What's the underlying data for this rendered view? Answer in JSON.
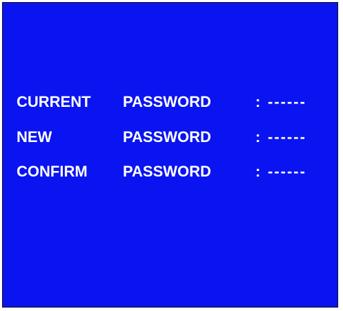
{
  "colors": {
    "screen_background": "#0a14f0",
    "text": "#ffffff"
  },
  "rows": [
    {
      "label": "CURRENT",
      "field": "PASSWORD",
      "separator": ":",
      "value": "------"
    },
    {
      "label": "NEW",
      "field": "PASSWORD",
      "separator": ":",
      "value": "------"
    },
    {
      "label": "CONFIRM",
      "field": "PASSWORD",
      "separator": ":",
      "value": "------"
    }
  ]
}
